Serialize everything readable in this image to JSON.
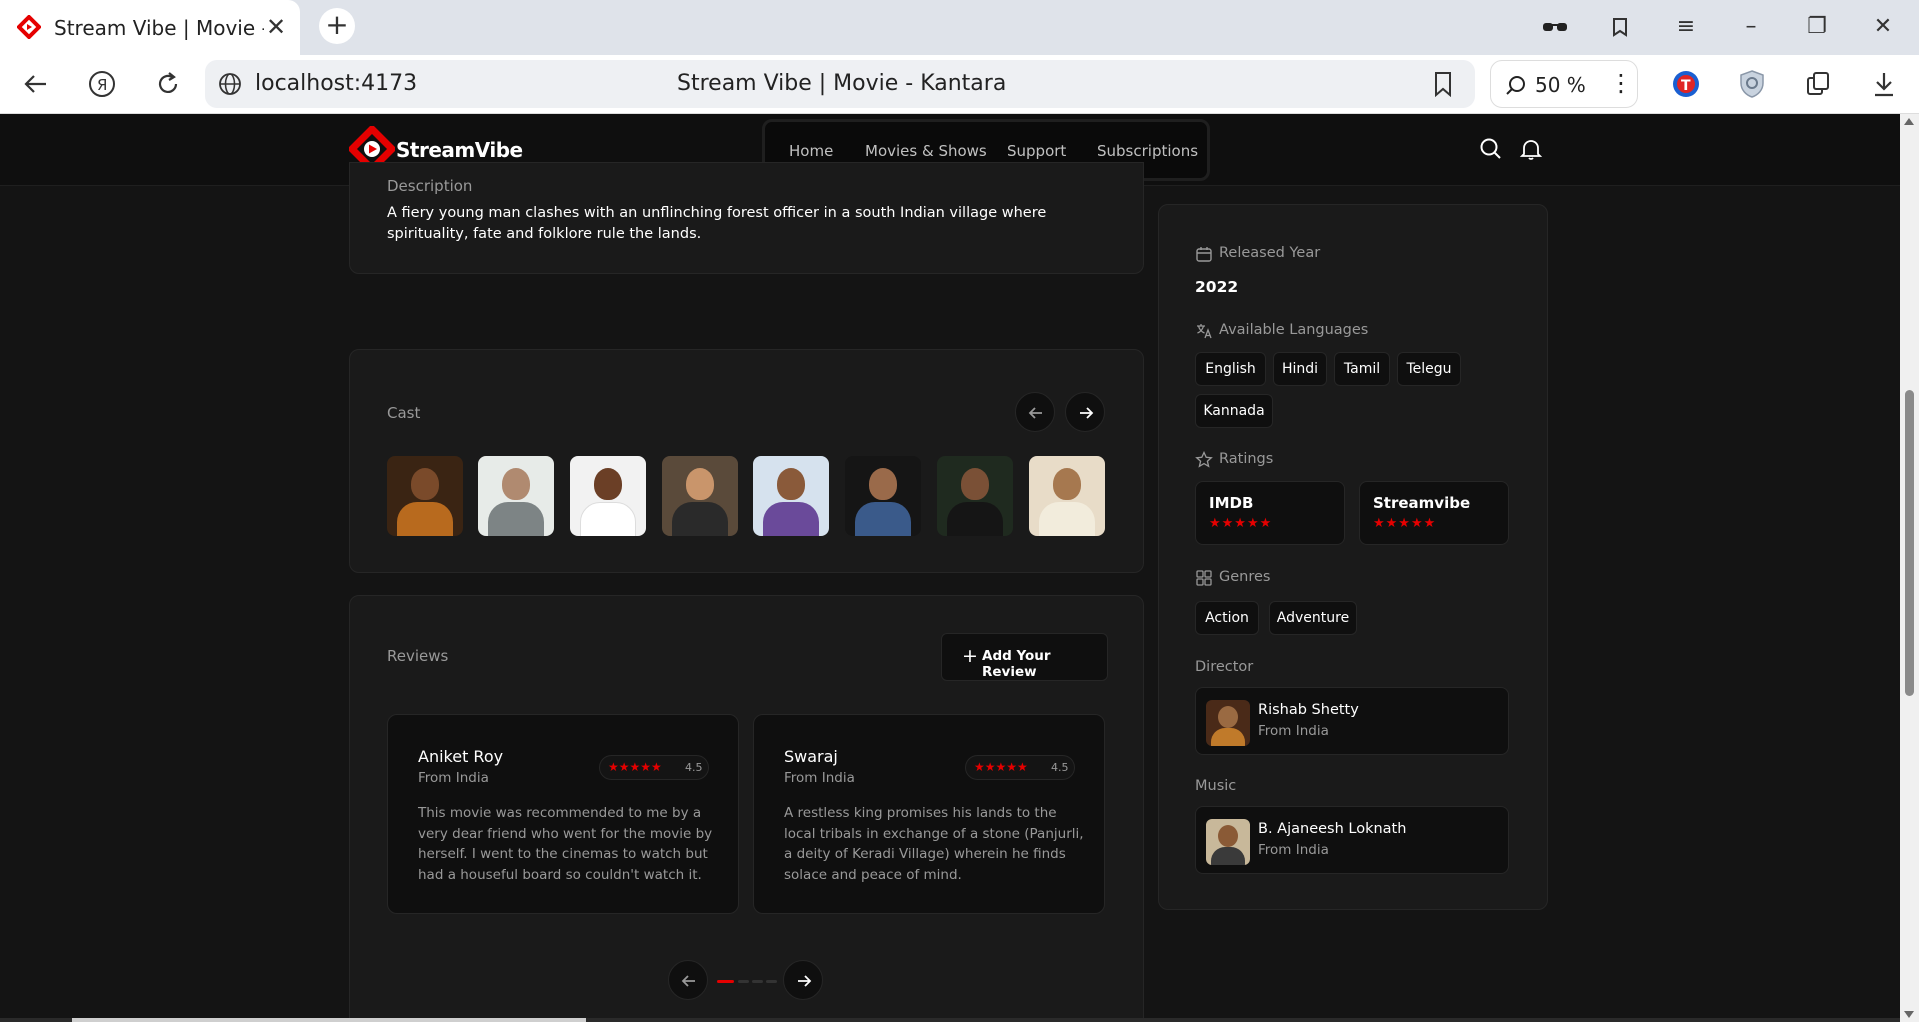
{
  "browser": {
    "tab_title": "Stream Vibe | Movie - Kantara",
    "url_host": "localhost:4173",
    "page_title": "Stream Vibe | Movie - Kantara",
    "zoom": "50 %"
  },
  "site": {
    "logo_text": "StreamVibe",
    "nav": [
      "Home",
      "Movies & Shows",
      "Support",
      "Subscriptions"
    ],
    "accent_color": "#e50000"
  },
  "description": {
    "label": "Description",
    "text": "A fiery young man clashes with an unflinching forest officer in a south Indian village where spirituality, fate and folklore rule the lands."
  },
  "cast": {
    "label": "Cast",
    "count": 8
  },
  "reviews": {
    "label": "Reviews",
    "add_button": "Add Your Review",
    "items": [
      {
        "name": "Aniket Roy",
        "from": "From India",
        "rating": 4.5,
        "rating_text": "4.5",
        "text": "This movie was recommended to me by a very dear friend who went for the movie by herself. I went to the cinemas to watch but had a houseful board so couldn't watch it."
      },
      {
        "name": "Swaraj",
        "from": "From India",
        "rating": 4.5,
        "rating_text": "4.5",
        "text": "A restless king promises his lands to the local tribals in exchange of a stone (Panjurli, a deity of Keradi Village) wherein he finds solace and peace of mind."
      }
    ],
    "page_count": 4,
    "active_page": 1
  },
  "sidebar": {
    "released_label": "Released Year",
    "released_year": "2022",
    "languages_label": "Available Languages",
    "languages": [
      "English",
      "Hindi",
      "Tamil",
      "Telegu",
      "Kannada"
    ],
    "ratings_label": "Ratings",
    "ratings": [
      {
        "name": "IMDB",
        "stars": 5
      },
      {
        "name": "Streamvibe",
        "stars": 5
      }
    ],
    "genres_label": "Genres",
    "genres": [
      "Action",
      "Adventure"
    ],
    "director_label": "Director",
    "director": {
      "name": "Rishab Shetty",
      "from": "From India"
    },
    "music_label": "Music",
    "music": {
      "name": "B. Ajaneesh Loknath",
      "from": "From India"
    }
  }
}
